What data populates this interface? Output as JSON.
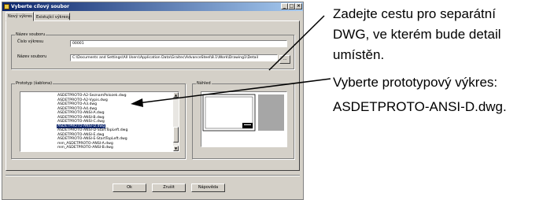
{
  "window": {
    "title": "Vyberte cílový soubor",
    "min": "_",
    "max": "□",
    "close": "×"
  },
  "tabs": [
    {
      "label": "Nový výkres"
    },
    {
      "label": "Existující výkresy"
    }
  ],
  "file_group": {
    "label": "Název souboru",
    "number_label": "Číslo výkresu",
    "number_value": "00001",
    "name_label": "Název souboru",
    "name_value": "C:\\Documents and Settings\\All Users\\Application Data\\Graitec\\AdvanceSteel\\8.1\\Work\\Drawing1\\Detail",
    "browse_label": "..."
  },
  "prototype_group": {
    "label": "Prototyp (šablona)",
    "items": [
      "ASDETPROTO-A2-SeznamPolozek.dwg",
      "ASDETPROTO-A2-Vypis.dwg",
      "ASDETPROTO-A3.dwg",
      "ASDETPROTO-A4.dwg",
      "ASDETPROTO-ANSI-A.dwg",
      "ASDETPROTO-ANSI-B.dwg",
      "ASDETPROTO-ANSI-C.dwg",
      "ASDETPROTO-ANSI-D.dwg",
      "ASDETPROTO-ANSI-D-StartTopLeft.dwg",
      "ASDETPROTO-ANSI-E.dwg",
      "ASDETPROTO-ANSI-E-StartTopLeft.dwg",
      "mm_ASDETPROTO-ANSI-A.dwg",
      "mm_ASDETPROTO-ANSI-B.dwg"
    ],
    "selected_item": "ASDETPROTO-ANSI-D.dwg"
  },
  "preview_group": {
    "label": "Náhled"
  },
  "buttons": {
    "ok": "Ok",
    "cancel": "Zrušit",
    "help": "Nápověda"
  },
  "annotations": {
    "path_note": [
      "Zadejte cestu pro separátní",
      "DWG, ve kterém bude detail",
      "umístěn."
    ],
    "prototype_note": [
      "Vyberte prototypový výkres:",
      "ASDETPROTO-ANSI-D.dwg."
    ]
  },
  "colors": {
    "titlebar_start": "#0a246a",
    "titlebar_end": "#a6caf0",
    "selection": "#0a246a",
    "dialog_face": "#d4d0c8"
  }
}
